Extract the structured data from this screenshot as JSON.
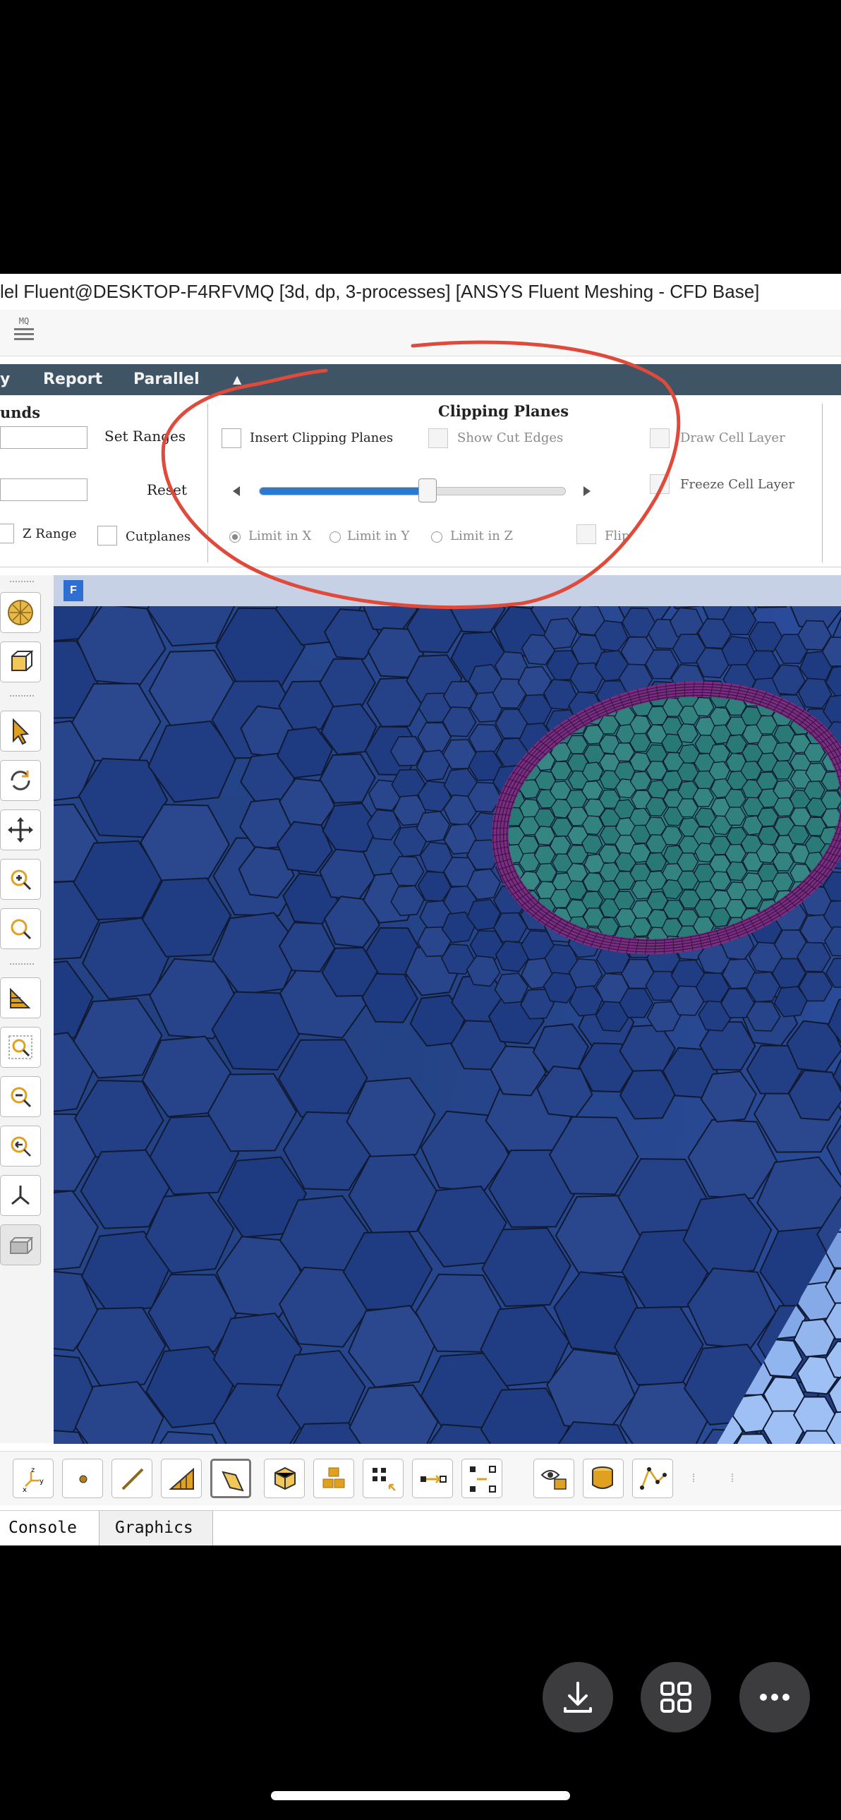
{
  "window": {
    "title": "lel Fluent@DESKTOP-F4RFVMQ  [3d, dp, 3-processes] [ANSYS Fluent Meshing - CFD Base]"
  },
  "menubar": {
    "items": [
      "y",
      "Report",
      "Parallel"
    ]
  },
  "bounds_group": {
    "heading": "unds",
    "set_ranges": "Set Ranges",
    "reset": "Reset",
    "z_range": "Z Range",
    "cutplanes": "Cutplanes"
  },
  "clipping": {
    "heading": "Clipping Planes",
    "insert_label": "Insert Clipping Planes",
    "show_cut_edges": "Show Cut Edges",
    "draw_cell_layer": "Draw Cell Layer",
    "freeze_cell_layer": "Freeze Cell Layer",
    "slider_fraction": 0.55,
    "limit_x": "Limit in X",
    "limit_y": "Limit in Y",
    "limit_z": "Limit in Z",
    "flip": "Flip",
    "selected_limit": "Limit in X"
  },
  "graphics_window": {
    "badge": "F"
  },
  "tabs": {
    "console": "Console",
    "graphics": "Graphics"
  },
  "colors": {
    "menubar": "#3f5566",
    "slider_fill": "#2a7ad4",
    "annotation": "#e04a3a",
    "mesh_outer": "#27438a",
    "mesh_ring": "#7a2d82",
    "mesh_inner": "#2f7d7e"
  },
  "icons": {
    "left_toolbar": [
      "mesh-sphere-icon",
      "box-icon",
      "select-arrow-icon",
      "rotate-icon",
      "pan-icon",
      "zoom-in-icon",
      "zoom-icon",
      "perspective-icon",
      "zoom-to-fit-icon",
      "zoom-out-icon",
      "zoom-previous-icon",
      "axes-icon",
      "view-box-icon"
    ],
    "bottom_toolbar": [
      "xyz-axes-icon",
      "point-icon",
      "line-icon",
      "triangle-icon",
      "face-icon",
      "cell-icon",
      "multi-cell-icon",
      "select-points-icon",
      "edge-select-icon",
      "region-select-icon",
      "visibility-icon",
      "cylinder-icon",
      "polyline-icon"
    ],
    "phone": [
      "download-icon",
      "grid-icon",
      "more-icon"
    ]
  }
}
